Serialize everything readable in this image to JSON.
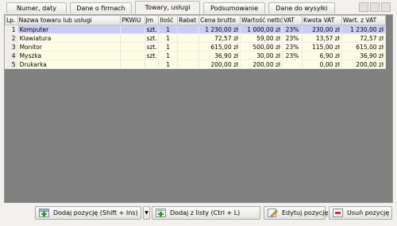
{
  "tabs": [
    {
      "label": "Numer, daty"
    },
    {
      "label": "Dane o firmach"
    },
    {
      "label": "Towary, usługi"
    },
    {
      "label": "Podsumowanie"
    },
    {
      "label": "Dane do wysyłki"
    }
  ],
  "grid": {
    "columns": [
      "Lp.",
      "Nazwa towaru lub usługi",
      "PKWiU",
      "Jm",
      "Ilość",
      "Rabat",
      "Cena brutto",
      "Wartość netto",
      "VAT",
      "Kwota VAT",
      "Wart. z VAT"
    ],
    "rows": [
      {
        "lp": "1",
        "name": "Komputer",
        "pkwiu": "",
        "jm": "szt.",
        "qty": "1",
        "rabat": "",
        "cena": "1 230,00 zł",
        "netto": "1 000,00 zł",
        "vat": "23%",
        "kwota": "230,00 zł",
        "brutto": "1 230,00 zł"
      },
      {
        "lp": "2",
        "name": "Klawiatura",
        "pkwiu": "",
        "jm": "szt.",
        "qty": "1",
        "rabat": "",
        "cena": "72,57 zł",
        "netto": "59,00 zł",
        "vat": "23%",
        "kwota": "13,57 zł",
        "brutto": "72,57 zł"
      },
      {
        "lp": "3",
        "name": "Monitor",
        "pkwiu": "",
        "jm": "szt.",
        "qty": "1",
        "rabat": "",
        "cena": "615,00 zł",
        "netto": "500,00 zł",
        "vat": "23%",
        "kwota": "115,00 zł",
        "brutto": "615,00 zł"
      },
      {
        "lp": "4",
        "name": "Myszka",
        "pkwiu": "",
        "jm": "szt.",
        "qty": "1",
        "rabat": "",
        "cena": "36,90 zł",
        "netto": "30,00 zł",
        "vat": "23%",
        "kwota": "6,90 zł",
        "brutto": "36,90 zł"
      },
      {
        "lp": "5",
        "name": "Drukarka",
        "pkwiu": "",
        "jm": "",
        "qty": "1",
        "rabat": "",
        "cena": "200,00 zł",
        "netto": "200,00 zł",
        "vat": "",
        "kwota": "0,00 zł",
        "brutto": "200,00 zł"
      }
    ]
  },
  "buttons": {
    "add": "Dodaj pozycję (Shift + Ins)",
    "add_from_list": "Dodaj z listy (Ctrl + L)",
    "edit": "Edytuj pozycję",
    "delete": "Usuń pozycję"
  },
  "colors": {
    "selected_row": "#c9ccf7",
    "row": "#fefde3",
    "empty_area": "#808080"
  }
}
